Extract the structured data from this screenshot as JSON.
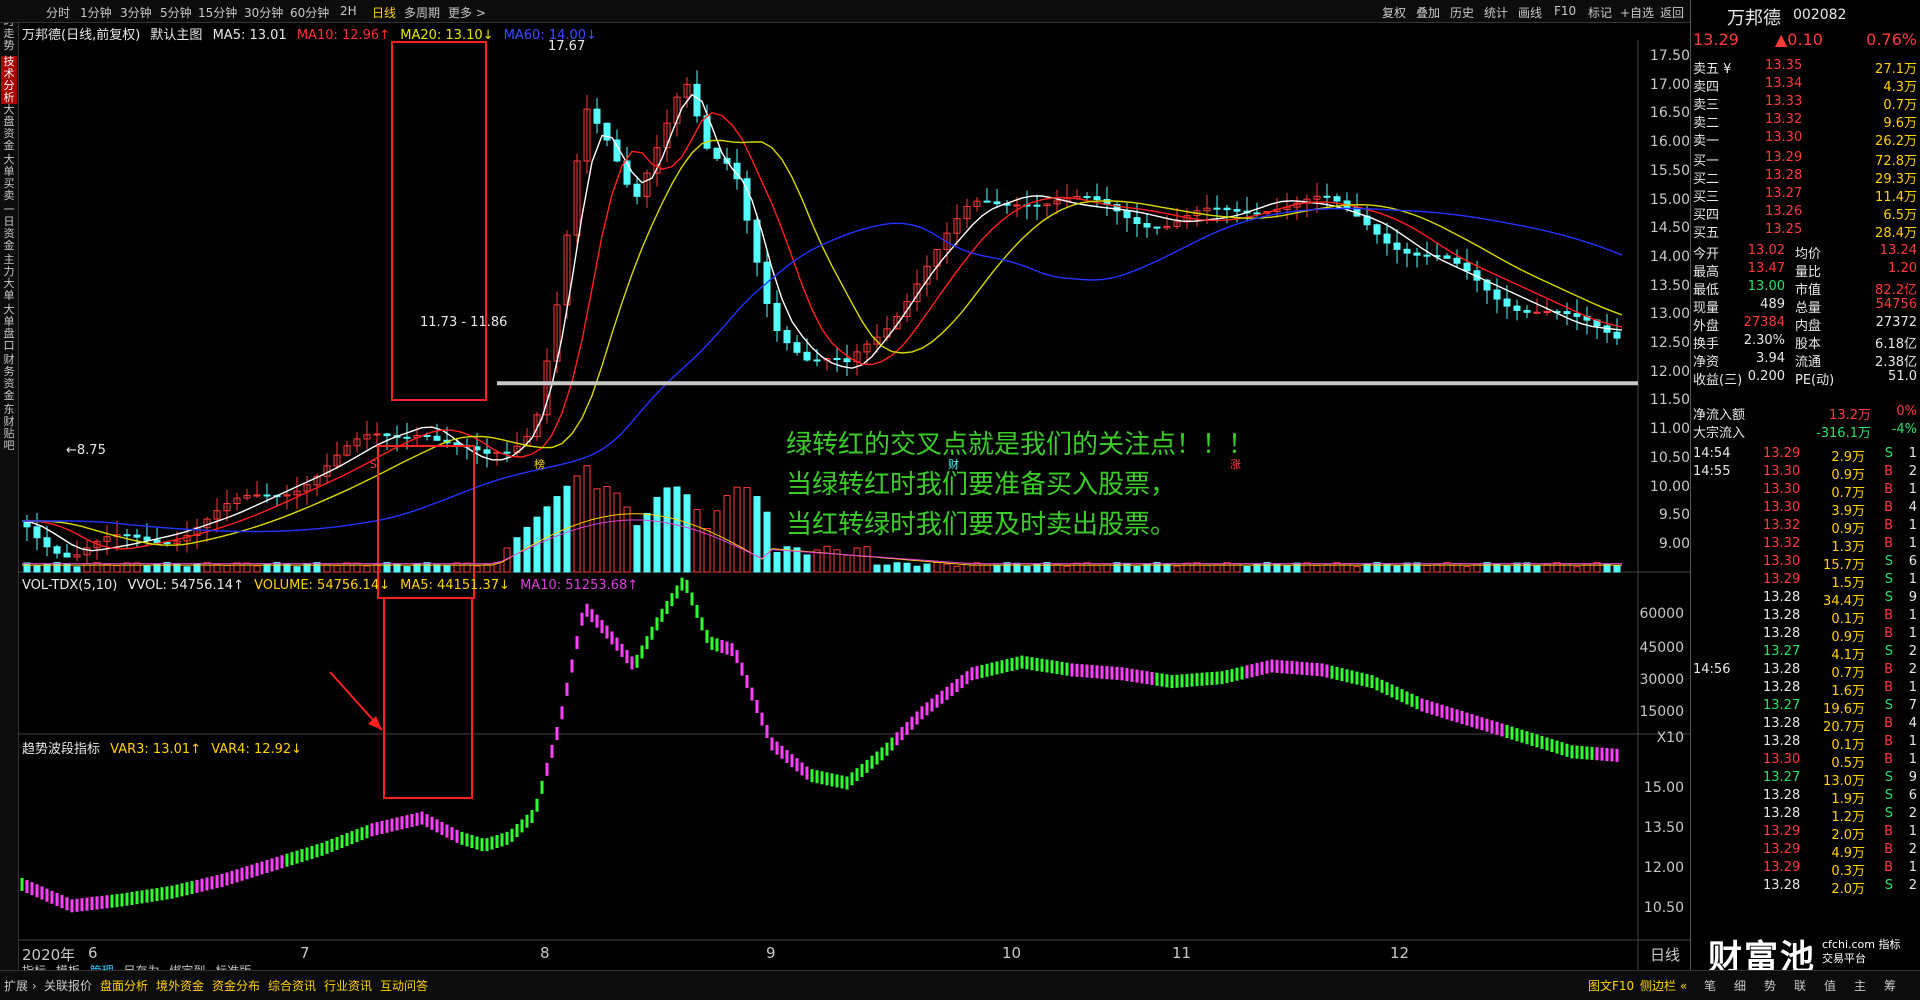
{
  "periods": [
    "分时",
    "1分钟",
    "3分钟",
    "5分钟",
    "15分钟",
    "30分钟",
    "60分钟",
    "2H",
    "日线",
    "多周期",
    "更多 >"
  ],
  "active_period": "日线",
  "right_tools": [
    "复权",
    "叠加",
    "历史",
    "统计",
    "画线",
    "F10",
    "标记",
    "+自选",
    "返回"
  ],
  "left_tabs": [
    "分时走势",
    "技术分析",
    "大盘资金",
    "大单买卖",
    "一日资金",
    "主力大单",
    "大单盘口",
    "财务资金",
    "东财贴吧"
  ],
  "main_info": {
    "stock": "万邦德(日线,前复权)",
    "template": "默认主图",
    "ma5": "MA5: 13.01",
    "ma10": "MA10: 12.96↑",
    "ma20": "MA20: 13.10↓",
    "ma60": "MA60: 14.00↓"
  },
  "price_axis": [
    "17.50",
    "17.00",
    "16.50",
    "16.00",
    "15.50",
    "15.00",
    "14.50",
    "14.00",
    "13.50",
    "13.00",
    "12.50",
    "12.00",
    "11.50",
    "11.00",
    "10.50",
    "10.00",
    "9.50",
    "9.00"
  ],
  "annotations": {
    "high": "17.67",
    "low": "8.75",
    "range": "11.73 - 11.86"
  },
  "event_markers": [
    "S",
    "榜",
    "财",
    "涨"
  ],
  "vol_info": {
    "name": "VOL-TDX(5,10)",
    "vvol": "VVOL: 54756.14↑",
    "volume": "VOLUME: 54756.14↓",
    "ma5": "MA5: 44151.37↓",
    "ma10": "MA10: 51253.68↑"
  },
  "vol_axis": [
    "60000",
    "45000",
    "30000",
    "15000",
    "X10"
  ],
  "ind_info": {
    "name": "趋势波段指标",
    "var3": "VAR3: 13.01↑",
    "var4": "VAR4: 12.92↓"
  },
  "ind_axis": [
    "15.00",
    "13.50",
    "12.00",
    "10.50"
  ],
  "x_axis": [
    "2020年",
    "6",
    "7",
    "8",
    "9",
    "10",
    "11",
    "12"
  ],
  "overlay_lines": [
    "绿转红的交叉点就是我们的关注点！！！",
    "当绿转红时我们要准备买入股票，",
    "当红转绿时我们要及时卖出股票。"
  ],
  "quote": {
    "name": "万邦德",
    "code": "002082",
    "price": "13.29",
    "change": "▲0.10",
    "pct": "0.76%"
  },
  "asks": [
    [
      "卖五 ¥",
      "13.35",
      "27.1万"
    ],
    [
      "卖四",
      "13.34",
      "4.3万"
    ],
    [
      "卖三",
      "13.33",
      "0.7万"
    ],
    [
      "卖二",
      "13.32",
      "9.6万"
    ],
    [
      "卖一",
      "13.30",
      "26.2万"
    ]
  ],
  "bids": [
    [
      "买一",
      "13.29",
      "72.8万"
    ],
    [
      "买二",
      "13.28",
      "29.3万"
    ],
    [
      "买三",
      "13.27",
      "11.4万"
    ],
    [
      "买四",
      "13.26",
      "6.5万"
    ],
    [
      "买五",
      "13.25",
      "28.4万"
    ]
  ],
  "stats": [
    [
      "今开",
      "13.02",
      "均价",
      "13.24"
    ],
    [
      "最高",
      "13.47",
      "量比",
      "1.20"
    ],
    [
      "最低",
      "13.00",
      "市值",
      "82.2亿"
    ],
    [
      "现量",
      "489",
      "总量",
      "54756"
    ],
    [
      "外盘",
      "27384",
      "内盘",
      "27372"
    ],
    [
      "换手",
      "2.30%",
      "股本",
      "6.18亿"
    ],
    [
      "净资",
      "3.94",
      "流通",
      "2.38亿"
    ],
    [
      "收益(三)",
      "0.200",
      "PE(动)",
      "51.0"
    ]
  ],
  "flow": [
    [
      "净流入额",
      "13.2万",
      "0%"
    ],
    [
      "大宗流入",
      "-316.1万",
      "-4%"
    ]
  ],
  "ticks": [
    [
      "14:54",
      "13.29",
      "2.9万",
      "S",
      "1"
    ],
    [
      "14:55",
      "13.30",
      "0.9万",
      "B",
      "2"
    ],
    [
      "",
      "13.30",
      "0.7万",
      "B",
      "1"
    ],
    [
      "",
      "13.30",
      "3.9万",
      "B",
      "4"
    ],
    [
      "",
      "13.32",
      "0.9万",
      "B",
      "1"
    ],
    [
      "",
      "13.32",
      "1.3万",
      "B",
      "1"
    ],
    [
      "",
      "13.30",
      "15.7万",
      "S",
      "6"
    ],
    [
      "",
      "13.29",
      "1.5万",
      "S",
      "1"
    ],
    [
      "",
      "13.28",
      "34.4万",
      "S",
      "9"
    ],
    [
      "",
      "13.28",
      "0.1万",
      "B",
      "1"
    ],
    [
      "",
      "13.28",
      "0.9万",
      "B",
      "1"
    ],
    [
      "",
      "13.27",
      "4.1万",
      "S",
      "2"
    ],
    [
      "14:56",
      "13.28",
      "0.7万",
      "B",
      "2"
    ],
    [
      "",
      "13.28",
      "1.6万",
      "B",
      "1"
    ],
    [
      "",
      "13.27",
      "19.6万",
      "S",
      "7"
    ],
    [
      "",
      "13.28",
      "20.7万",
      "B",
      "4"
    ],
    [
      "",
      "13.28",
      "0.1万",
      "B",
      "1"
    ],
    [
      "",
      "13.30",
      "0.5万",
      "B",
      "1"
    ],
    [
      "",
      "13.27",
      "13.0万",
      "S",
      "9"
    ],
    [
      "",
      "13.28",
      "1.9万",
      "S",
      "6"
    ],
    [
      "",
      "13.28",
      "1.2万",
      "S",
      "2"
    ],
    [
      "",
      "13.29",
      "2.0万",
      "B",
      "1"
    ],
    [
      "",
      "13.29",
      "4.9万",
      "B",
      "2"
    ],
    [
      "",
      "13.29",
      "0.3万",
      "B",
      "1"
    ],
    [
      "",
      "13.28",
      "2.0万",
      "S",
      "2"
    ]
  ],
  "bottom_tabs": [
    "扩展 ›",
    "关联报价",
    "盘面分析",
    "境外资金",
    "资金分布",
    "综合资讯",
    "行业资讯",
    "互动问答"
  ],
  "chart_toolbar": [
    "指标",
    "模板",
    "管理",
    "另存为",
    "绑定到",
    "标准版"
  ],
  "bottom_right": [
    "图文F10",
    "侧边栏 «"
  ],
  "side_tabs": [
    "笔",
    "细",
    "势",
    "联",
    "值",
    "主",
    "筹"
  ],
  "axis_mode": "日线",
  "watermark": "财富池",
  "watermark_sub": "cfchi.com 指标交易平台"
}
